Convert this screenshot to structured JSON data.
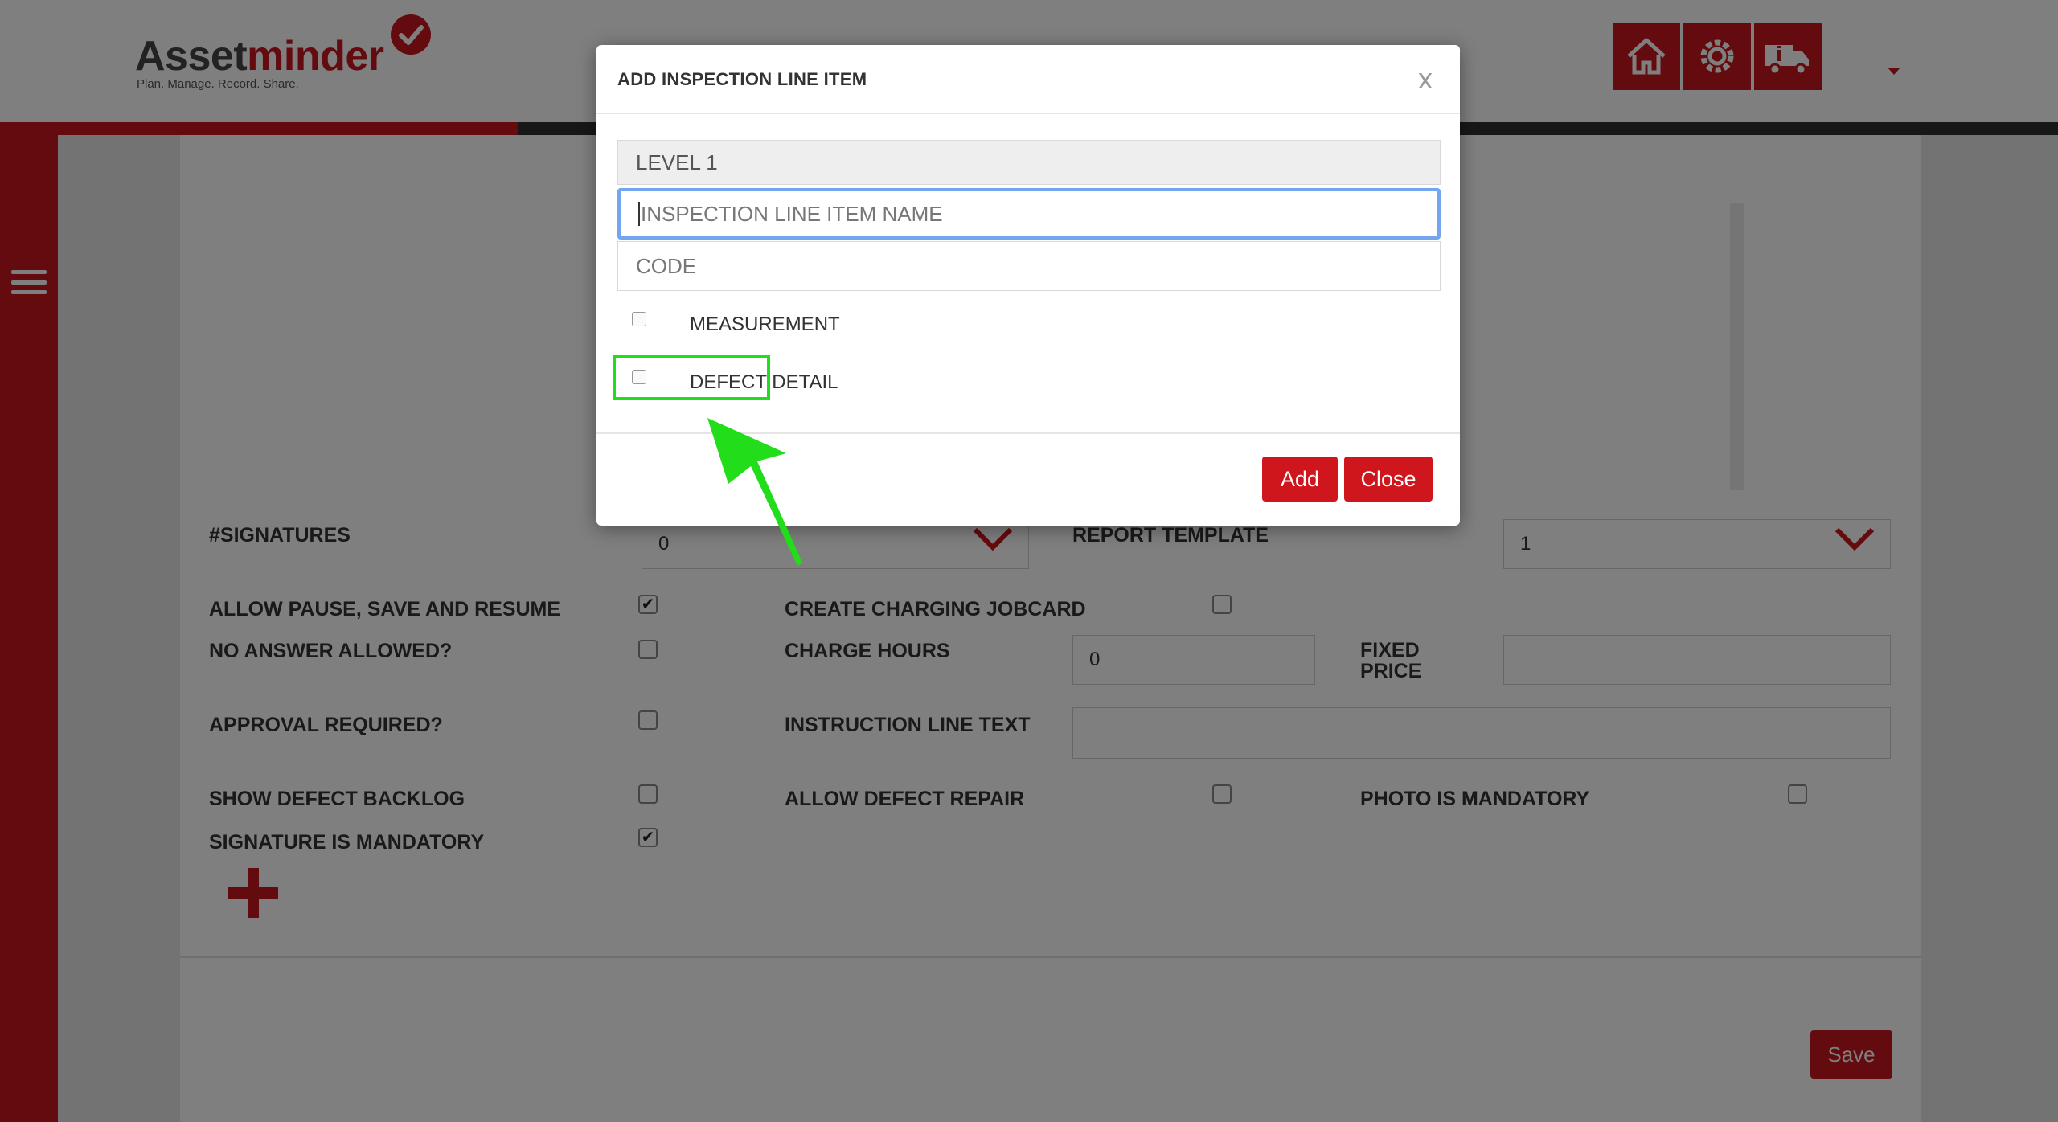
{
  "brand": {
    "name_part1": "Asset",
    "name_part2": "minder",
    "tagline": "Plan. Manage. Record. Share.",
    "accent_color": "#c8171e"
  },
  "header": {
    "icons": [
      "home-icon",
      "settings-icon",
      "truck-info-icon"
    ]
  },
  "form": {
    "signatures_label": "#SIGNATURES",
    "signatures_value": "0",
    "report_template_label": "REPORT TEMPLATE",
    "report_template_value": "1",
    "allow_pause_label": "ALLOW PAUSE, SAVE AND RESUME",
    "allow_pause_checked": true,
    "create_charging_label": "CREATE CHARGING JOBCARD",
    "create_charging_checked": false,
    "no_answer_label": "NO ANSWER ALLOWED?",
    "no_answer_checked": false,
    "charge_hours_label": "CHARGE HOURS",
    "charge_hours_value": "0",
    "fixed_price_label_1": "FIXED",
    "fixed_price_label_2": "PRICE",
    "fixed_price_value": "",
    "approval_label": "APPROVAL REQUIRED?",
    "approval_checked": false,
    "instruction_label": "INSTRUCTION LINE TEXT",
    "instruction_value": "",
    "show_defect_label": "SHOW DEFECT BACKLOG",
    "show_defect_checked": false,
    "allow_repair_label": "ALLOW DEFECT REPAIR",
    "allow_repair_checked": false,
    "photo_mandatory_label": "PHOTO IS MANDATORY",
    "photo_mandatory_checked": false,
    "signature_mandatory_label": "SIGNATURE IS MANDATORY",
    "signature_mandatory_checked": true,
    "check_glyph": "✔",
    "save_label": "Save"
  },
  "modal": {
    "title": "ADD INSPECTION LINE ITEM",
    "close_x": "x",
    "level_value": "LEVEL 1",
    "name_placeholder": "INSPECTION LINE ITEM NAME",
    "code_placeholder": "CODE",
    "measurement_label": "MEASUREMENT",
    "defect_detail_label": "DEFECT DETAIL",
    "add_label": "Add",
    "close_label": "Close",
    "highlight_color": "#22dd1a",
    "focus_color": "#74a6f0"
  }
}
